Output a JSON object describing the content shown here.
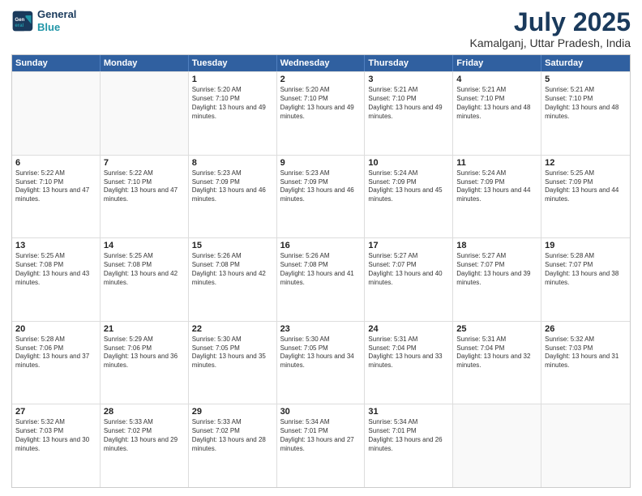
{
  "logo": {
    "line1": "General",
    "line2": "Blue"
  },
  "header": {
    "month": "July 2025",
    "location": "Kamalganj, Uttar Pradesh, India"
  },
  "weekdays": [
    "Sunday",
    "Monday",
    "Tuesday",
    "Wednesday",
    "Thursday",
    "Friday",
    "Saturday"
  ],
  "rows": [
    [
      {
        "day": "",
        "sunrise": "",
        "sunset": "",
        "daylight": ""
      },
      {
        "day": "",
        "sunrise": "",
        "sunset": "",
        "daylight": ""
      },
      {
        "day": "1",
        "sunrise": "Sunrise: 5:20 AM",
        "sunset": "Sunset: 7:10 PM",
        "daylight": "Daylight: 13 hours and 49 minutes."
      },
      {
        "day": "2",
        "sunrise": "Sunrise: 5:20 AM",
        "sunset": "Sunset: 7:10 PM",
        "daylight": "Daylight: 13 hours and 49 minutes."
      },
      {
        "day": "3",
        "sunrise": "Sunrise: 5:21 AM",
        "sunset": "Sunset: 7:10 PM",
        "daylight": "Daylight: 13 hours and 49 minutes."
      },
      {
        "day": "4",
        "sunrise": "Sunrise: 5:21 AM",
        "sunset": "Sunset: 7:10 PM",
        "daylight": "Daylight: 13 hours and 48 minutes."
      },
      {
        "day": "5",
        "sunrise": "Sunrise: 5:21 AM",
        "sunset": "Sunset: 7:10 PM",
        "daylight": "Daylight: 13 hours and 48 minutes."
      }
    ],
    [
      {
        "day": "6",
        "sunrise": "Sunrise: 5:22 AM",
        "sunset": "Sunset: 7:10 PM",
        "daylight": "Daylight: 13 hours and 47 minutes."
      },
      {
        "day": "7",
        "sunrise": "Sunrise: 5:22 AM",
        "sunset": "Sunset: 7:10 PM",
        "daylight": "Daylight: 13 hours and 47 minutes."
      },
      {
        "day": "8",
        "sunrise": "Sunrise: 5:23 AM",
        "sunset": "Sunset: 7:09 PM",
        "daylight": "Daylight: 13 hours and 46 minutes."
      },
      {
        "day": "9",
        "sunrise": "Sunrise: 5:23 AM",
        "sunset": "Sunset: 7:09 PM",
        "daylight": "Daylight: 13 hours and 46 minutes."
      },
      {
        "day": "10",
        "sunrise": "Sunrise: 5:24 AM",
        "sunset": "Sunset: 7:09 PM",
        "daylight": "Daylight: 13 hours and 45 minutes."
      },
      {
        "day": "11",
        "sunrise": "Sunrise: 5:24 AM",
        "sunset": "Sunset: 7:09 PM",
        "daylight": "Daylight: 13 hours and 44 minutes."
      },
      {
        "day": "12",
        "sunrise": "Sunrise: 5:25 AM",
        "sunset": "Sunset: 7:09 PM",
        "daylight": "Daylight: 13 hours and 44 minutes."
      }
    ],
    [
      {
        "day": "13",
        "sunrise": "Sunrise: 5:25 AM",
        "sunset": "Sunset: 7:08 PM",
        "daylight": "Daylight: 13 hours and 43 minutes."
      },
      {
        "day": "14",
        "sunrise": "Sunrise: 5:25 AM",
        "sunset": "Sunset: 7:08 PM",
        "daylight": "Daylight: 13 hours and 42 minutes."
      },
      {
        "day": "15",
        "sunrise": "Sunrise: 5:26 AM",
        "sunset": "Sunset: 7:08 PM",
        "daylight": "Daylight: 13 hours and 42 minutes."
      },
      {
        "day": "16",
        "sunrise": "Sunrise: 5:26 AM",
        "sunset": "Sunset: 7:08 PM",
        "daylight": "Daylight: 13 hours and 41 minutes."
      },
      {
        "day": "17",
        "sunrise": "Sunrise: 5:27 AM",
        "sunset": "Sunset: 7:07 PM",
        "daylight": "Daylight: 13 hours and 40 minutes."
      },
      {
        "day": "18",
        "sunrise": "Sunrise: 5:27 AM",
        "sunset": "Sunset: 7:07 PM",
        "daylight": "Daylight: 13 hours and 39 minutes."
      },
      {
        "day": "19",
        "sunrise": "Sunrise: 5:28 AM",
        "sunset": "Sunset: 7:07 PM",
        "daylight": "Daylight: 13 hours and 38 minutes."
      }
    ],
    [
      {
        "day": "20",
        "sunrise": "Sunrise: 5:28 AM",
        "sunset": "Sunset: 7:06 PM",
        "daylight": "Daylight: 13 hours and 37 minutes."
      },
      {
        "day": "21",
        "sunrise": "Sunrise: 5:29 AM",
        "sunset": "Sunset: 7:06 PM",
        "daylight": "Daylight: 13 hours and 36 minutes."
      },
      {
        "day": "22",
        "sunrise": "Sunrise: 5:30 AM",
        "sunset": "Sunset: 7:05 PM",
        "daylight": "Daylight: 13 hours and 35 minutes."
      },
      {
        "day": "23",
        "sunrise": "Sunrise: 5:30 AM",
        "sunset": "Sunset: 7:05 PM",
        "daylight": "Daylight: 13 hours and 34 minutes."
      },
      {
        "day": "24",
        "sunrise": "Sunrise: 5:31 AM",
        "sunset": "Sunset: 7:04 PM",
        "daylight": "Daylight: 13 hours and 33 minutes."
      },
      {
        "day": "25",
        "sunrise": "Sunrise: 5:31 AM",
        "sunset": "Sunset: 7:04 PM",
        "daylight": "Daylight: 13 hours and 32 minutes."
      },
      {
        "day": "26",
        "sunrise": "Sunrise: 5:32 AM",
        "sunset": "Sunset: 7:03 PM",
        "daylight": "Daylight: 13 hours and 31 minutes."
      }
    ],
    [
      {
        "day": "27",
        "sunrise": "Sunrise: 5:32 AM",
        "sunset": "Sunset: 7:03 PM",
        "daylight": "Daylight: 13 hours and 30 minutes."
      },
      {
        "day": "28",
        "sunrise": "Sunrise: 5:33 AM",
        "sunset": "Sunset: 7:02 PM",
        "daylight": "Daylight: 13 hours and 29 minutes."
      },
      {
        "day": "29",
        "sunrise": "Sunrise: 5:33 AM",
        "sunset": "Sunset: 7:02 PM",
        "daylight": "Daylight: 13 hours and 28 minutes."
      },
      {
        "day": "30",
        "sunrise": "Sunrise: 5:34 AM",
        "sunset": "Sunset: 7:01 PM",
        "daylight": "Daylight: 13 hours and 27 minutes."
      },
      {
        "day": "31",
        "sunrise": "Sunrise: 5:34 AM",
        "sunset": "Sunset: 7:01 PM",
        "daylight": "Daylight: 13 hours and 26 minutes."
      },
      {
        "day": "",
        "sunrise": "",
        "sunset": "",
        "daylight": ""
      },
      {
        "day": "",
        "sunrise": "",
        "sunset": "",
        "daylight": ""
      }
    ]
  ]
}
